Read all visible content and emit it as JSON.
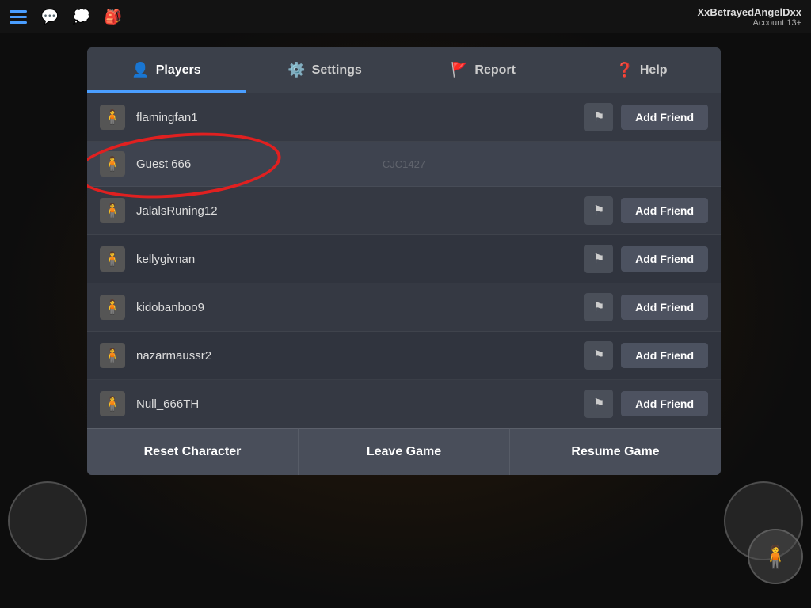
{
  "topBar": {
    "username": "XxBetrayedAngelDxx",
    "account": "Account 13+"
  },
  "tabs": [
    {
      "id": "players",
      "label": "Players",
      "icon": "👤",
      "active": true
    },
    {
      "id": "settings",
      "label": "Settings",
      "icon": "⚙️",
      "active": false
    },
    {
      "id": "report",
      "label": "Report",
      "icon": "🚩",
      "active": false
    },
    {
      "id": "help",
      "label": "Help",
      "icon": "❓",
      "active": false
    }
  ],
  "players": [
    {
      "name": "flamingfan1",
      "avatar": "🧍",
      "hasFlag": true,
      "hasAddFriend": true,
      "selected": false
    },
    {
      "name": "Guest 666",
      "avatar": "🧍",
      "hasFlag": false,
      "hasAddFriend": false,
      "selected": true,
      "watermark": "CJC1427"
    },
    {
      "name": "JalalsRuning12",
      "avatar": "🧍",
      "hasFlag": true,
      "hasAddFriend": true,
      "selected": false
    },
    {
      "name": "kellygivnan",
      "avatar": "🧍",
      "hasFlag": true,
      "hasAddFriend": true,
      "selected": false
    },
    {
      "name": "kidobanboo9",
      "avatar": "🧍",
      "hasFlag": true,
      "hasAddFriend": true,
      "selected": false
    },
    {
      "name": "nazarmaussr2",
      "avatar": "🧍",
      "hasFlag": true,
      "hasAddFriend": true,
      "selected": false
    },
    {
      "name": "Null_666TH",
      "avatar": "🧍",
      "hasFlag": true,
      "hasAddFriend": true,
      "selected": false
    }
  ],
  "bottomButtons": [
    {
      "id": "reset",
      "label": "Reset Character"
    },
    {
      "id": "leave",
      "label": "Leave Game"
    },
    {
      "id": "resume",
      "label": "Resume Game"
    }
  ],
  "addFriendLabel": "Add Friend",
  "flagSymbol": "⚑"
}
